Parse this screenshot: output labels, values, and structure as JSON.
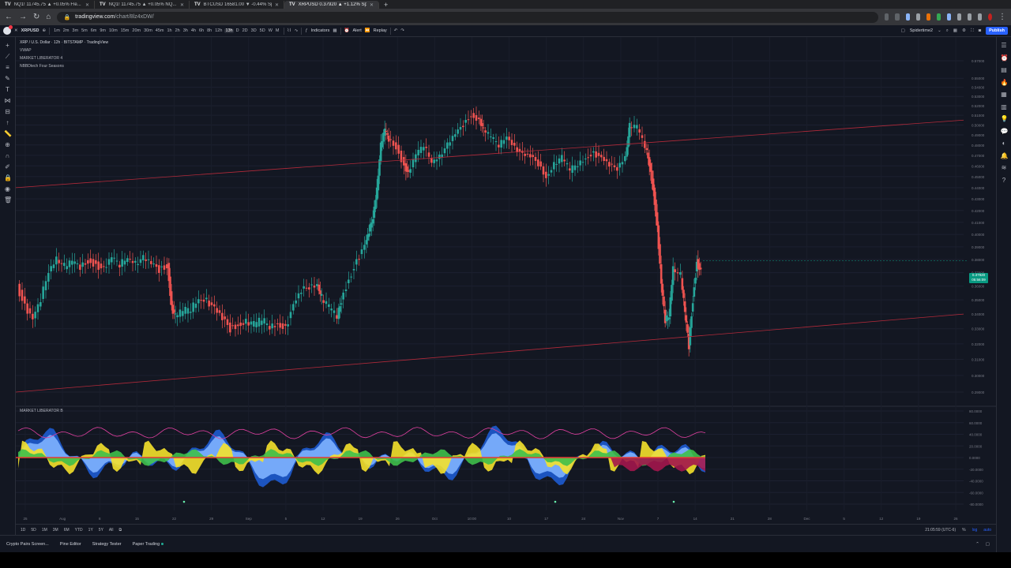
{
  "browser": {
    "tabs": [
      {
        "icon": "TV",
        "label": "NQ1! 11745.75 ▲ +0.05% Fle..."
      },
      {
        "icon": "TV",
        "label": "NQ1! 11745.75 ▲ +0.05% NQ..."
      },
      {
        "icon": "TV",
        "label": "BTCUSD 16581.00 ▼ -0.44% Sp..."
      },
      {
        "icon": "TV",
        "label": "XRPUSD 0.37920 ▲ +1.12% Spi..."
      }
    ],
    "url_host": "tradingview.com",
    "url_path": "/chart/8lz4xDW/"
  },
  "toolbar": {
    "symbol": "XRPUSD",
    "intervals": [
      "1m",
      "2m",
      "3m",
      "5m",
      "6m",
      "9m",
      "10m",
      "15m",
      "20m",
      "30m",
      "45m",
      "1h",
      "2h",
      "3h",
      "4h",
      "6h",
      "8h",
      "12h",
      "13h",
      "D",
      "2D",
      "3D",
      "5D",
      "W",
      "M"
    ],
    "selected_interval": "13h",
    "indicators": "Indicators",
    "alert": "Alert",
    "replay": "Replay",
    "layout_name": "Spidertime2",
    "publish": "Publish"
  },
  "chart": {
    "title": "XRP / U.S. Dollar · 12h · BITSTAMP · TradingView",
    "legend_1": "VWAP",
    "legend_2": "MARKET LIBERATOR 4",
    "legend_3": "NBBDtech Four Seasons",
    "osc_title": "MARKET LIBERATOR B",
    "price_ticks": [
      "0.57000",
      "0.55000",
      "0.54000",
      "0.53000",
      "0.52000",
      "0.51000",
      "0.50000",
      "0.49000",
      "0.48000",
      "0.47000",
      "0.46000",
      "0.45000",
      "0.44000",
      "0.43000",
      "0.42000",
      "0.41000",
      "0.40000",
      "0.39000",
      "0.38000",
      "0.37000",
      "0.36000",
      "0.35000",
      "0.34000",
      "0.33000",
      "0.32000",
      "0.31000",
      "0.30000",
      "0.29000"
    ],
    "osc_ticks": [
      "80.0000",
      "60.0000",
      "40.0000",
      "20.0000",
      "0.0000",
      "-20.0000",
      "-40.0000",
      "-60.0000",
      "-80.0000"
    ],
    "time_labels": [
      "25",
      "Aug",
      "8",
      "15",
      "22",
      "29",
      "Sep",
      "5",
      "12",
      "19",
      "26",
      "Oct",
      "10:00",
      "10",
      "17",
      "24",
      "Nov",
      "7",
      "14",
      "21",
      "28",
      "Dec",
      "5",
      "12",
      "19",
      "26"
    ],
    "current_price": "0.37920",
    "countdown": "05:56:09",
    "colors": {
      "up": "#26a69a",
      "down": "#ef5350",
      "trendline": "#b22a3a",
      "bg": "#131722"
    }
  },
  "rangebar": {
    "ranges": [
      "1D",
      "5D",
      "1M",
      "3M",
      "6M",
      "YTD",
      "1Y",
      "5Y",
      "All"
    ],
    "clock": "21:05:59 (UTC-6)",
    "pct": "%",
    "log": "log",
    "auto": "auto"
  },
  "panel": {
    "crypto": "Crypto Pairs Screen...",
    "pine": "Pine Editor",
    "strategy": "Strategy Tester",
    "paper": "Paper Trading"
  }
}
